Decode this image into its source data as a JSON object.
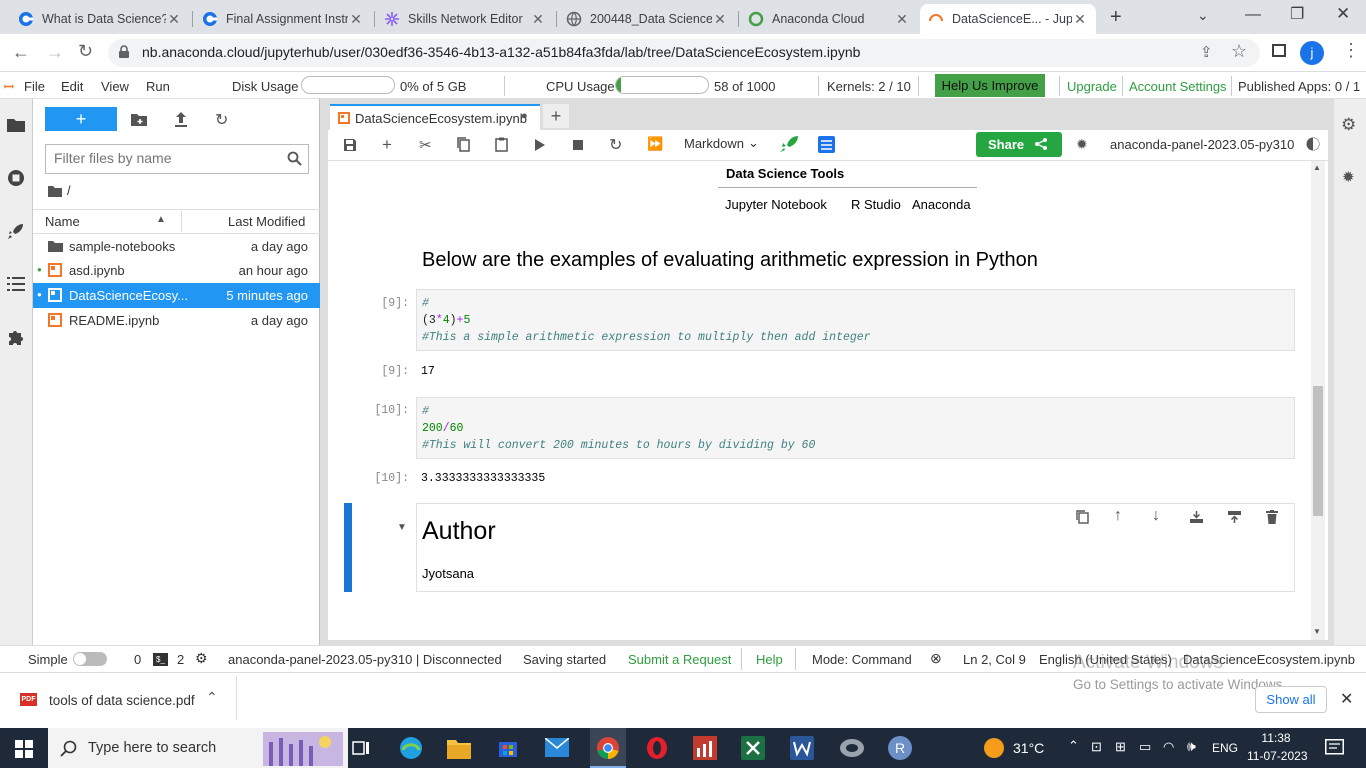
{
  "browser": {
    "tabs": [
      {
        "title": "What is Data Science?",
        "icon": "chrome-g-icon"
      },
      {
        "title": "Final Assignment Instr",
        "icon": "chrome-g-icon"
      },
      {
        "title": "Skills Network Editor",
        "icon": "skills-network-icon"
      },
      {
        "title": "200448_Data Science_",
        "icon": "globe-icon"
      },
      {
        "title": "Anaconda Cloud",
        "icon": "anaconda-icon"
      },
      {
        "title": "DataScienceE... - Jupyt",
        "icon": "jupyter-loading-icon"
      }
    ],
    "url": "nb.anaconda.cloud/jupyterhub/user/030edf36-3546-4b13-a132-a51b84fa3fda/lab/tree/DataScienceEcosystem.ipynb",
    "profile_initial": "j"
  },
  "menubar": {
    "items": [
      "File",
      "Edit",
      "View",
      "Run"
    ],
    "disk_label": "Disk Usage",
    "disk_value": "0% of 5 GB",
    "disk_fraction": 0.0,
    "cpu_label": "CPU Usage",
    "cpu_value": "58 of 1000",
    "cpu_fraction": 0.058,
    "kernels": "Kernels: 2 / 10",
    "help_improve": "Help Us Improve",
    "upgrade": "Upgrade",
    "account_settings": "Account Settings",
    "published_apps": "Published Apps: 0 / 1"
  },
  "filebrowser": {
    "new_label": "+",
    "filter_placeholder": "Filter files by name",
    "path": "/",
    "col_name": "Name",
    "col_modified": "Last Modified",
    "files": [
      {
        "name": "sample-notebooks",
        "modified": "a day ago",
        "type": "folder",
        "running": false,
        "selected": false
      },
      {
        "name": "asd.ipynb",
        "modified": "an hour ago",
        "type": "notebook",
        "running": true,
        "selected": false
      },
      {
        "name": "DataScienceEcosy...",
        "modified": "5 minutes ago",
        "type": "notebook",
        "running": true,
        "selected": true
      },
      {
        "name": "README.ipynb",
        "modified": "a day ago",
        "type": "notebook",
        "running": false,
        "selected": false
      }
    ]
  },
  "notebook": {
    "tab_title": "DataScienceEcosystem.ipynb",
    "cell_type": "Markdown",
    "share_label": "Share",
    "kernel_name": "anaconda-panel-2023.05-py310",
    "table_header": "Data Science Tools",
    "table_row": [
      "Jupyter Notebook",
      "R Studio",
      "Anaconda"
    ],
    "heading": "Below are the examples of evaluating arithmetic expression in Python",
    "cells": [
      {
        "in_prompt": "[9]:",
        "line1": "#",
        "line2_a": "(3",
        "line2_b": "*",
        "line2_c": "4",
        "line2_d": ")",
        "line2_e": "+",
        "line2_f": "5",
        "line3": "#This a simple arithmetic expression to multiply then add integer",
        "out_prompt": "[9]:",
        "output": "17"
      },
      {
        "in_prompt": "[10]:",
        "line1": "#",
        "line2_a": "200",
        "line2_b": "/",
        "line2_c": "60",
        "line3": "#This will convert 200 minutes to hours by dividing by 60",
        "out_prompt": "[10]:",
        "output": "3.3333333333333335"
      }
    ],
    "author_heading": "Author",
    "author_name": "Jyotsana"
  },
  "statusbar": {
    "simple": "Simple",
    "count_terminals": "0",
    "count_kernels": "2",
    "kernel_status": "anaconda-panel-2023.05-py310 | Disconnected",
    "saving": "Saving started",
    "submit_request": "Submit a Request",
    "help": "Help",
    "mode": "Mode: Command",
    "position": "Ln 2, Col 9",
    "language": "English (United States)",
    "filename": "DataScienceEcosystem.ipynb"
  },
  "download": {
    "filename": "tools of data science.pdf",
    "show_all": "Show all",
    "watermark_title": "Activate Windows",
    "watermark_sub": "Go to Settings to activate Windows."
  },
  "taskbar": {
    "search_placeholder": "Type here to search",
    "temperature": "31°C",
    "language": "ENG",
    "time": "11:38",
    "date": "11-07-2023"
  },
  "colors": {
    "jupyter_blue": "#2196f3",
    "help_green": "#43a047",
    "share_green": "#26a641",
    "link_green": "#2e9e3e",
    "taskbar": "#1e2a3a"
  }
}
